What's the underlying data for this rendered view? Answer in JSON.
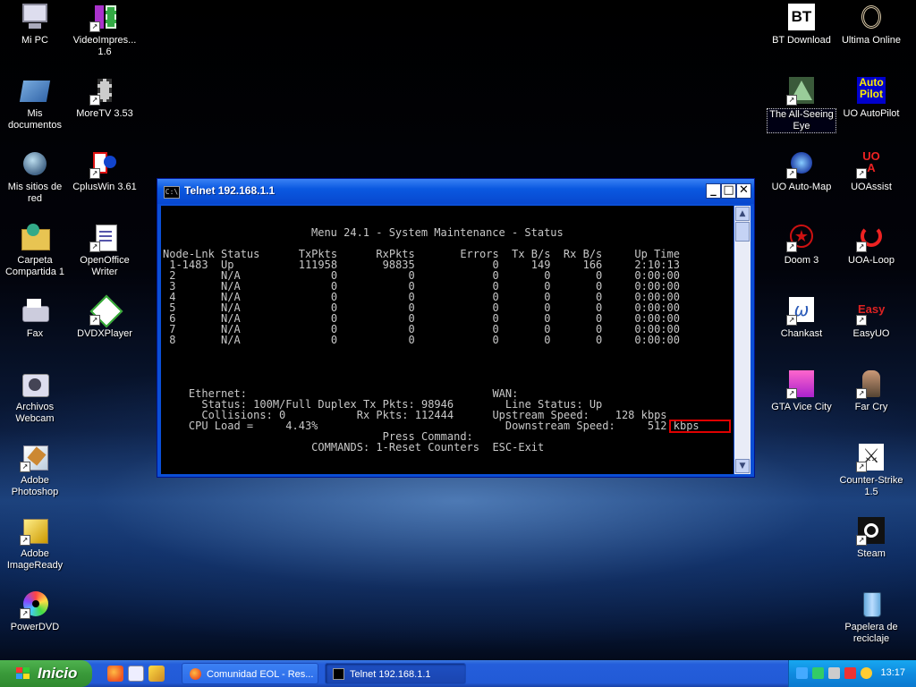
{
  "desktop": {
    "icons": [
      {
        "label": "Mi PC"
      },
      {
        "label": "VideoImpres... 1.6"
      },
      {
        "label": "Mis documentos"
      },
      {
        "label": "MoreTV 3.53"
      },
      {
        "label": "Mis sitios de red"
      },
      {
        "label": "CplusWin 3.61"
      },
      {
        "label": "Carpeta Compartida 1"
      },
      {
        "label": "OpenOffice Writer"
      },
      {
        "label": "Fax"
      },
      {
        "label": "DVDXPlayer"
      },
      {
        "label": "Archivos Webcam"
      },
      {
        "label": "Adobe Photoshop"
      },
      {
        "label": "Adobe ImageReady"
      },
      {
        "label": "PowerDVD"
      },
      {
        "label": "BT Download"
      },
      {
        "label": "Ultima Online"
      },
      {
        "label": "The All-Seeing Eye"
      },
      {
        "label": "UO AutoPilot"
      },
      {
        "label": "UO Auto-Map"
      },
      {
        "label": "UOAssist"
      },
      {
        "label": "Doom 3"
      },
      {
        "label": "UOA-Loop"
      },
      {
        "label": "Chankast"
      },
      {
        "label": "EasyUO"
      },
      {
        "label": "GTA Vice City"
      },
      {
        "label": "Far Cry"
      },
      {
        "label": "Counter-Strike 1.5"
      },
      {
        "label": "Steam"
      },
      {
        "label": "Papelera de reciclaje"
      }
    ],
    "icon_glyphs": {
      "bt": "BT",
      "autopilot": "Auto Pilot",
      "easy": "Easy",
      "uoa": "UO A",
      "titlebar_icon": "C:\\"
    }
  },
  "window": {
    "title": "Telnet 192.168.1.1",
    "minimize": "_",
    "maximize": "□",
    "close": "✕",
    "console": {
      "menu_title": "Menu 24.1 - System Maintenance - Status",
      "table_header": "Node-Lnk Status      TxPkts      RxPkts       Errors  Tx B/s  Rx B/s     Up Time",
      "rows": [
        " 1-1483  Up          111958       98835            0     149     166     2:10:13",
        " 2       N/A              0           0            0       0       0     0:00:00",
        " 3       N/A              0           0            0       0       0     0:00:00",
        " 4       N/A              0           0            0       0       0     0:00:00",
        " 5       N/A              0           0            0       0       0     0:00:00",
        " 6       N/A              0           0            0       0       0     0:00:00",
        " 7       N/A              0           0            0       0       0     0:00:00",
        " 8       N/A              0           0            0       0       0     0:00:00"
      ],
      "ethernet_line": "    Ethernet:                                      WAN:",
      "status_line": "      Status: 100M/Full Duplex Tx Pkts: 98946        Line Status: Up",
      "collisions_line": "      Collisions: 0           Rx Pkts: 112444      Upstream Speed:    128 kbps",
      "cpu_line": "    CPU Load =     4.43%                             Downstream Speed:     512 kbps",
      "press_command": "                                  Press Command:",
      "commands": "                       COMMANDS: 1-Reset Counters  ESC-Exit"
    }
  },
  "taskbar": {
    "start_label": "Inicio",
    "tasks": [
      {
        "label": "Comunidad EOL - Res..."
      },
      {
        "label": "Telnet 192.168.1.1"
      }
    ],
    "clock": "13:17",
    "colors": {
      "start": "#3a9a3a",
      "bar": "#245edb",
      "tray": "#0f8be0"
    }
  }
}
